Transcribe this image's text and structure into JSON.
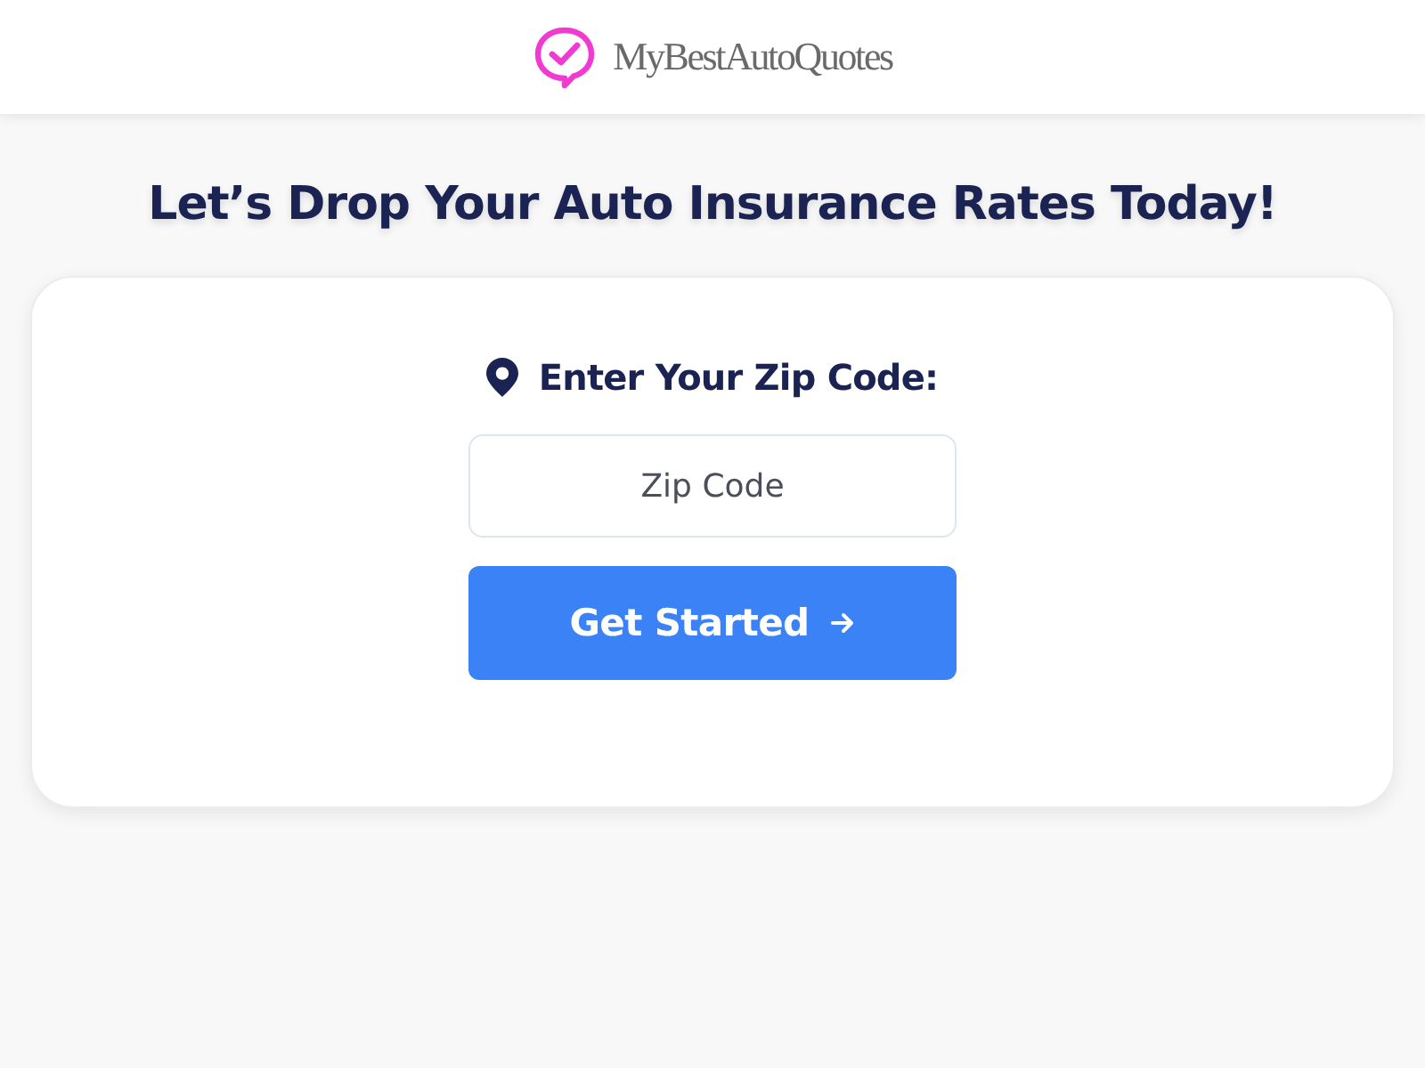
{
  "header": {
    "logo_text": "MyBestAutoQuotes"
  },
  "headline": "Let’s Drop Your Auto Insurance Rates Today!",
  "form": {
    "label": "Enter Your Zip Code:",
    "zip_field": {
      "placeholder": "Zip Code"
    },
    "button": {
      "label": "Get Started"
    }
  }
}
